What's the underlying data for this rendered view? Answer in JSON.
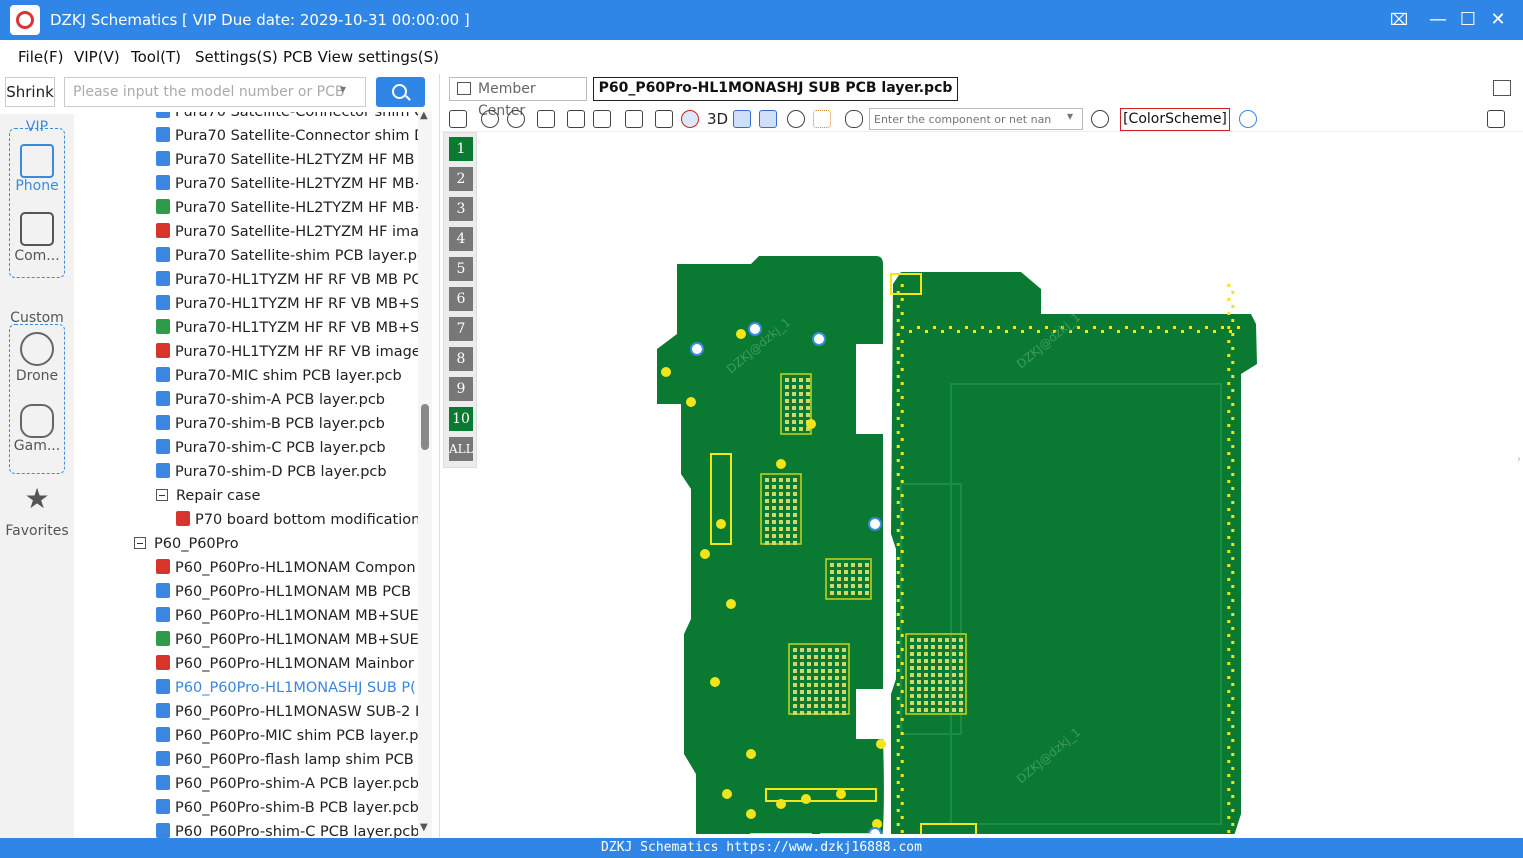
{
  "window": {
    "title": "DZKJ Schematics [ VIP Due date: 2029-10-31 00:00:00 ]"
  },
  "menu": [
    "File(F)",
    "VIP(V)",
    "Tool(T)",
    "Settings(S)",
    "PCB View settings(S)"
  ],
  "left": {
    "shrink_label": "Shrink",
    "search_placeholder": "Please input the model number or PCB"
  },
  "nav": {
    "vip_label": "VIP",
    "phone_label": "Phone",
    "computer_label": "Com...",
    "custom_label": "Custom",
    "drone_label": "Drone",
    "game_label": "Gam...",
    "favorites_label": "Favorites"
  },
  "tree": [
    {
      "label": "Pura70 Satellite-Connector shim C",
      "type": "pcb",
      "level": 2
    },
    {
      "label": "Pura70 Satellite-Connector shim D",
      "type": "pcb",
      "level": 2
    },
    {
      "label": "Pura70 Satellite-HL2TYZM HF MB I",
      "type": "pcb",
      "level": 2
    },
    {
      "label": "Pura70 Satellite-HL2TYZM HF MB+",
      "type": "pcb",
      "level": 2
    },
    {
      "label": "Pura70 Satellite-HL2TYZM HF MB+",
      "type": "img",
      "level": 2
    },
    {
      "label": "Pura70 Satellite-HL2TYZM HF imag",
      "type": "pdf",
      "level": 2
    },
    {
      "label": "Pura70 Satellite-shim PCB layer.pcl",
      "type": "pcb",
      "level": 2
    },
    {
      "label": "Pura70-HL1TYZM HF RF VB MB PC",
      "type": "pcb",
      "level": 2
    },
    {
      "label": "Pura70-HL1TYZM HF RF VB MB+SU",
      "type": "pcb",
      "level": 2
    },
    {
      "label": "Pura70-HL1TYZM HF RF VB MB+SU",
      "type": "img",
      "level": 2
    },
    {
      "label": "Pura70-HL1TYZM HF RF VB image.",
      "type": "pdf",
      "level": 2
    },
    {
      "label": "Pura70-MIC shim PCB layer.pcb",
      "type": "pcb",
      "level": 2
    },
    {
      "label": "Pura70-shim-A PCB layer.pcb",
      "type": "pcb",
      "level": 2
    },
    {
      "label": "Pura70-shim-B PCB layer.pcb",
      "type": "pcb",
      "level": 2
    },
    {
      "label": "Pura70-shim-C PCB layer.pcb",
      "type": "pcb",
      "level": 2
    },
    {
      "label": "Pura70-shim-D PCB layer.pcb",
      "type": "pcb",
      "level": 2
    },
    {
      "label": "Repair case",
      "type": "folder",
      "level": 2
    },
    {
      "label": "P70 board bottom modification",
      "type": "pdf",
      "level": 3
    },
    {
      "label": "P60_P60Pro",
      "type": "folder",
      "level": 1
    },
    {
      "label": "P60_P60Pro-HL1MONAM Compon",
      "type": "pdf",
      "level": 2
    },
    {
      "label": "P60_P60Pro-HL1MONAM MB PCB",
      "type": "pcb",
      "level": 2
    },
    {
      "label": "P60_P60Pro-HL1MONAM MB+SUE",
      "type": "pcb",
      "level": 2
    },
    {
      "label": "P60_P60Pro-HL1MONAM MB+SUE",
      "type": "img",
      "level": 2
    },
    {
      "label": "P60_P60Pro-HL1MONAM Mainbor",
      "type": "pdf",
      "level": 2
    },
    {
      "label": "P60_P60Pro-HL1MONASHJ SUB P(",
      "type": "pcb",
      "level": 2,
      "selected": true
    },
    {
      "label": "P60_P60Pro-HL1MONASW SUB-2 I",
      "type": "pcb",
      "level": 2
    },
    {
      "label": "P60_P60Pro-MIC shim PCB layer.pc",
      "type": "pcb",
      "level": 2
    },
    {
      "label": "P60_P60Pro-flash lamp shim PCB l",
      "type": "pcb",
      "level": 2
    },
    {
      "label": "P60_P60Pro-shim-A PCB layer.pcb",
      "type": "pcb",
      "level": 2
    },
    {
      "label": "P60_P60Pro-shim-B PCB layer.pcb",
      "type": "pcb",
      "level": 2
    },
    {
      "label": "P60_P60Pro-shim-C PCB layer.pcb",
      "type": "pcb",
      "level": 2
    }
  ],
  "tabs": {
    "member_center": "Member Center",
    "active_file": "P60_P60Pro-HL1MONASHJ SUB PCB layer.pcb"
  },
  "toolbar": {
    "label_3d": "3D",
    "component_placeholder": "Enter the component or net nan",
    "colorscheme": "[ColorScheme]"
  },
  "layers": [
    "1",
    "2",
    "3",
    "4",
    "5",
    "6",
    "7",
    "8",
    "9",
    "10",
    "ALL"
  ],
  "active_layer": "10",
  "watermark": "DZKJ@dzkj_1",
  "status": "DZKJ Schematics https://www.dzkj16888.com",
  "colors": {
    "accent": "#2f86e6",
    "pcb_green": "#0a7a32",
    "pad_yellow": "#f2e61a"
  }
}
